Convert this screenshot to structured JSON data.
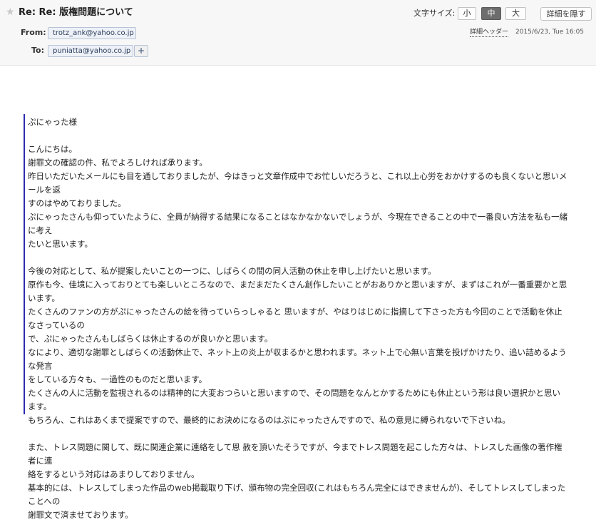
{
  "header": {
    "subject": "Re: Re: 版権問題について",
    "from_label": "From:",
    "from_address": "trotz_ank@yahoo.co.jp",
    "to_label": "To:",
    "to_address": "puniatta@yahoo.co.jp",
    "add_recipient": "+",
    "font_size_label": "文字サイズ:",
    "font_sizes": [
      "小",
      "中",
      "大"
    ],
    "selected_font_size": "中",
    "hide_details_label": "詳細を隠す",
    "detail_header_link": "詳細ヘッダー",
    "date": "2015/6/23, Tue 16:05"
  },
  "body": {
    "lines": [
      "ぷにゃった様",
      "",
      "こんにちは。",
      "謝罪文の確認の件、私でよろしければ承ります。",
      "昨日いただいたメールにも目を通しておりましたが、今はきっと文章作成中でお忙しいだろうと、これ以上心労をおかけするのも良くないと思いメールを返",
      "すのはやめておりました。",
      "ぷにゃったさんも仰っていたように、全員が納得する結果になることはなかなかないでしょうが、今現在できることの中で一番良い方法を私も一緒に考え",
      "たいと思います。",
      "",
      "今後の対応として、私が提案したいことの一つに、しばらくの間の同人活動の休止を申し上げたいと思います。",
      "原作も今、佳境に入っておりとても楽しいところなので、まだまだたくさん創作したいことがおありかと思いますが、まずはこれが一番重要かと思います。",
      "たくさんのファンの方がぷにゃったさんの絵を待っていらっしゃると 思いますが、やはりはじめに指摘して下さった方も今回のことで活動を休止なさっているの",
      "で、ぷにゃったさんもしばらくは休止するのが良いかと思います。",
      "なにより、適切な謝罪としばらくの活動休止で、ネット上の炎上が収まるかと思われます。ネット上で心無い言葉を投げかけたり、追い詰めるような発言",
      "をしている方々も、一過性のものだと思います。",
      "たくさんの人に活動を監視されるのは精神的に大変おつらいと思いますので、その問題をなんとかするためにも休止という形は良い選択かと思います。",
      "もちろん、これはあくまで提案ですので、最終的にお決めになるのはぷにゃったさんですので、私の意見に縛られないで下さいね。",
      "",
      "また、トレス問題に関して、既に関連企業に連絡をして恩 赦を頂いたそうですが、今までトレス問題を起こした方々は、トレスした画像の著作権者に連",
      "絡をするという対応はあまりしておりません。",
      "基本的には、トレスしてしまった作品のweb掲載取り下げ、頒布物の完全回収(これはもちろん完全にはできませんが)、そしてトレスしてしまったことへの",
      "謝罪文で済ませております。"
    ]
  }
}
